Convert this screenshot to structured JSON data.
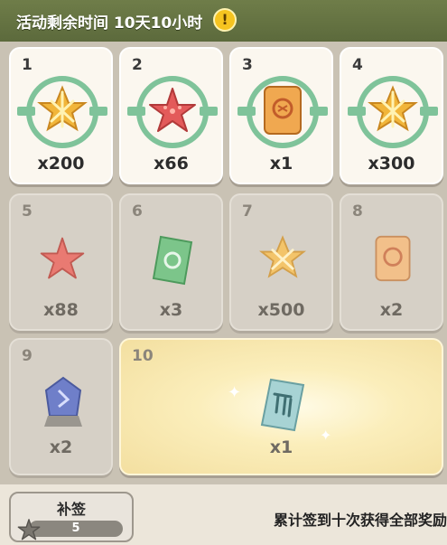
{
  "banner": {
    "timer_text": "活动剩余时间 10天10小时",
    "info_icon": "exclamation-icon"
  },
  "rewards": [
    {
      "day": "1",
      "qty": "x200",
      "item": "gold-star-icon",
      "state": "claimed"
    },
    {
      "day": "2",
      "qty": "x66",
      "item": "red-starfish-icon",
      "state": "claimed"
    },
    {
      "day": "3",
      "qty": "x1",
      "item": "scroll-icon",
      "state": "claimed"
    },
    {
      "day": "4",
      "qty": "x300",
      "item": "gold-star-icon",
      "state": "claimed"
    },
    {
      "day": "5",
      "qty": "x88",
      "item": "red-starfish-icon",
      "state": "locked"
    },
    {
      "day": "6",
      "qty": "x3",
      "item": "green-ticket-icon",
      "state": "locked"
    },
    {
      "day": "7",
      "qty": "x500",
      "item": "gold-star-icon",
      "state": "locked"
    },
    {
      "day": "8",
      "qty": "x2",
      "item": "scroll-icon",
      "state": "locked"
    },
    {
      "day": "9",
      "qty": "x2",
      "item": "blue-crystal-icon",
      "state": "locked"
    },
    {
      "day": "10",
      "qty": "x1",
      "item": "blue-card-icon",
      "state": "final"
    }
  ],
  "footer": {
    "resign_label": "补签",
    "resign_count": "5",
    "hint_text": "累计签到十次获得全部奖励"
  },
  "colors": {
    "claimed_ring": "#7fc39a",
    "star_gold": "#f1b53a",
    "starfish_red": "#e35a5a"
  }
}
